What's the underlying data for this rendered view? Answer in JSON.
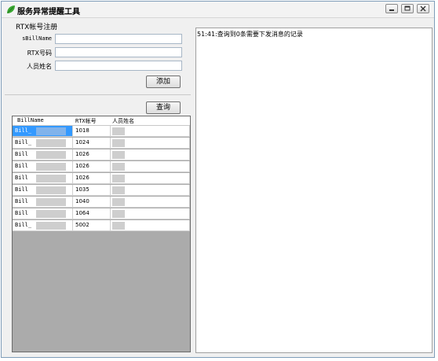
{
  "window": {
    "title": "服务异常提醒工具",
    "controls": [
      "minimize-icon",
      "restore-icon",
      "close-icon"
    ]
  },
  "form": {
    "section_title": "RTX帐号注册",
    "fields": [
      {
        "label": "sBillName",
        "value": "",
        "placeholder": ""
      },
      {
        "label": "RTX号码",
        "value": "",
        "placeholder": ""
      },
      {
        "label": "人员姓名",
        "value": "",
        "placeholder": ""
      }
    ],
    "add_button": "添加",
    "query_button": "查询"
  },
  "grid": {
    "columns": [
      "BillName",
      "RTX帐号",
      "人员姓名"
    ],
    "rows": [
      {
        "billname": "Bill_",
        "rtx": "1018",
        "name": "",
        "selected": true
      },
      {
        "billname": "Bill_",
        "rtx": "1024",
        "name": "",
        "selected": false
      },
      {
        "billname": "Bill",
        "rtx": "1026",
        "name": "",
        "selected": false
      },
      {
        "billname": "Bill",
        "rtx": "1026",
        "name": "",
        "selected": false
      },
      {
        "billname": "Bill",
        "rtx": "1026",
        "name": "",
        "selected": false
      },
      {
        "billname": "Bill",
        "rtx": "1035",
        "name": "",
        "selected": false
      },
      {
        "billname": "Bill",
        "rtx": "1040",
        "name": "",
        "selected": false
      },
      {
        "billname": "Bill",
        "rtx": "1064",
        "name": "",
        "selected": false
      },
      {
        "billname": "Bill_",
        "rtx": "5002",
        "name": "",
        "selected": false
      }
    ]
  },
  "log": {
    "lines": [
      "51:41:查询到0条需要下发消息的记录"
    ]
  },
  "colors": {
    "selection": "#3399ff",
    "grid_background": "#ababab",
    "window_background": "#f0f0f0"
  }
}
